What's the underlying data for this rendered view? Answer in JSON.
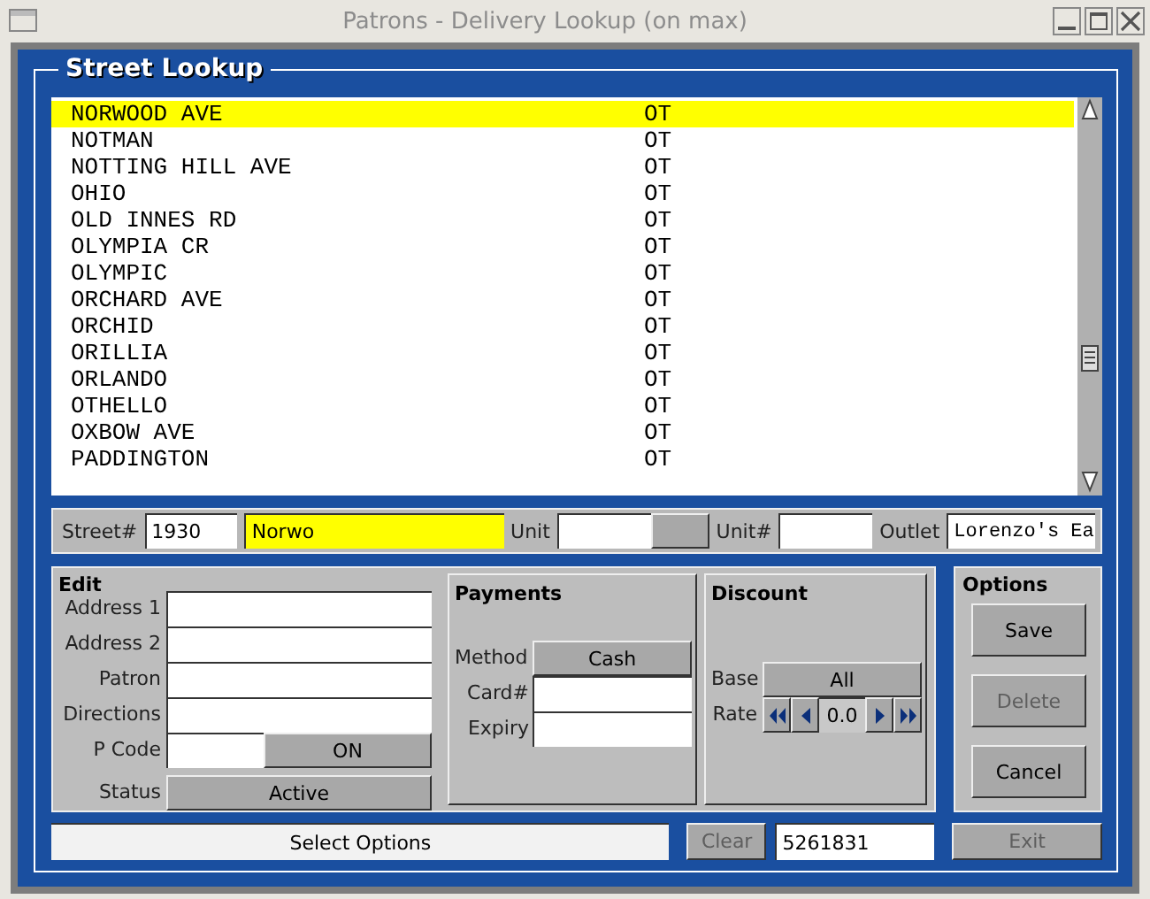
{
  "window": {
    "title": "Patrons - Delivery Lookup (on max)"
  },
  "street_lookup": {
    "title": "Street Lookup",
    "rows": [
      {
        "name": "NORWOOD AVE",
        "code": "OT",
        "selected": true
      },
      {
        "name": "NOTMAN",
        "code": "OT",
        "selected": false
      },
      {
        "name": "NOTTING HILL AVE",
        "code": "OT",
        "selected": false
      },
      {
        "name": "OHIO",
        "code": "OT",
        "selected": false
      },
      {
        "name": "OLD INNES RD",
        "code": "OT",
        "selected": false
      },
      {
        "name": "OLYMPIA CR",
        "code": "OT",
        "selected": false
      },
      {
        "name": "OLYMPIC",
        "code": "OT",
        "selected": false
      },
      {
        "name": "ORCHARD AVE",
        "code": "OT",
        "selected": false
      },
      {
        "name": "ORCHID",
        "code": "OT",
        "selected": false
      },
      {
        "name": "ORILLIA",
        "code": "OT",
        "selected": false
      },
      {
        "name": "ORLANDO",
        "code": "OT",
        "selected": false
      },
      {
        "name": "OTHELLO",
        "code": "OT",
        "selected": false
      },
      {
        "name": "OXBOW AVE",
        "code": "OT",
        "selected": false
      },
      {
        "name": "PADDINGTON",
        "code": "OT",
        "selected": false
      }
    ]
  },
  "street_bar": {
    "street_no_label": "Street#",
    "street_no": "1930",
    "street_name": "Norwo",
    "street_name_focused": true,
    "unit_label": "Unit",
    "unit_no_label": "Unit#",
    "outlet_label": "Outlet",
    "outlet": "Lorenzo's Ea"
  },
  "edit": {
    "title": "Edit",
    "fields": [
      {
        "label": "Address 1"
      },
      {
        "label": "Address 2"
      },
      {
        "label": "Patron"
      },
      {
        "label": "Directions"
      }
    ],
    "pcode_label": "P Code",
    "pcode_toggle": "ON",
    "status_label": "Status",
    "status": "Active"
  },
  "payments": {
    "title": "Payments",
    "method_label": "Method",
    "method": "Cash",
    "card_label": "Card#",
    "expiry_label": "Expiry"
  },
  "discount": {
    "title": "Discount",
    "base_label": "Base",
    "base": "All",
    "rate_label": "Rate",
    "rate": "0.0"
  },
  "options": {
    "title": "Options",
    "buttons": [
      {
        "label": "Save",
        "disabled": false
      },
      {
        "label": "Delete",
        "disabled": true
      },
      {
        "label": "Cancel",
        "disabled": false
      }
    ]
  },
  "footer": {
    "message": "Select Options",
    "clear": {
      "label": "Clear",
      "disabled": true
    },
    "number": "5261831",
    "exit": {
      "label": "Exit",
      "disabled": true
    }
  }
}
